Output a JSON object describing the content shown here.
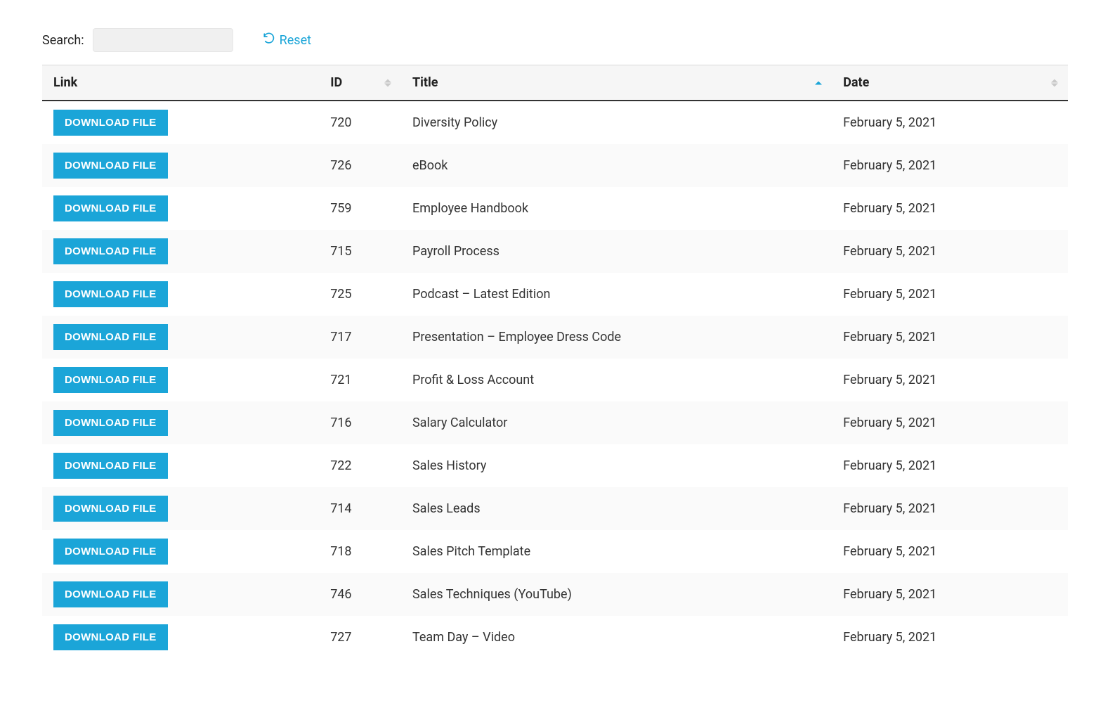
{
  "search": {
    "label": "Search:",
    "value": "",
    "reset_label": "Reset"
  },
  "table": {
    "download_button_label": "DOWNLOAD FILE",
    "columns": {
      "link": "Link",
      "id": "ID",
      "title": "Title",
      "date": "Date"
    },
    "sorted_column": "title",
    "sorted_direction": "asc",
    "rows": [
      {
        "id": "720",
        "title": "Diversity Policy",
        "date": "February 5, 2021"
      },
      {
        "id": "726",
        "title": "eBook",
        "date": "February 5, 2021"
      },
      {
        "id": "759",
        "title": "Employee Handbook",
        "date": "February 5, 2021"
      },
      {
        "id": "715",
        "title": "Payroll Process",
        "date": "February 5, 2021"
      },
      {
        "id": "725",
        "title": "Podcast – Latest Edition",
        "date": "February 5, 2021"
      },
      {
        "id": "717",
        "title": "Presentation – Employee Dress Code",
        "date": "February 5, 2021"
      },
      {
        "id": "721",
        "title": "Profit & Loss Account",
        "date": "February 5, 2021"
      },
      {
        "id": "716",
        "title": "Salary Calculator",
        "date": "February 5, 2021"
      },
      {
        "id": "722",
        "title": "Sales History",
        "date": "February 5, 2021"
      },
      {
        "id": "714",
        "title": "Sales Leads",
        "date": "February 5, 2021"
      },
      {
        "id": "718",
        "title": "Sales Pitch Template",
        "date": "February 5, 2021"
      },
      {
        "id": "746",
        "title": "Sales Techniques (YouTube)",
        "date": "February 5, 2021"
      },
      {
        "id": "727",
        "title": "Team Day – Video",
        "date": "February 5, 2021"
      }
    ]
  }
}
